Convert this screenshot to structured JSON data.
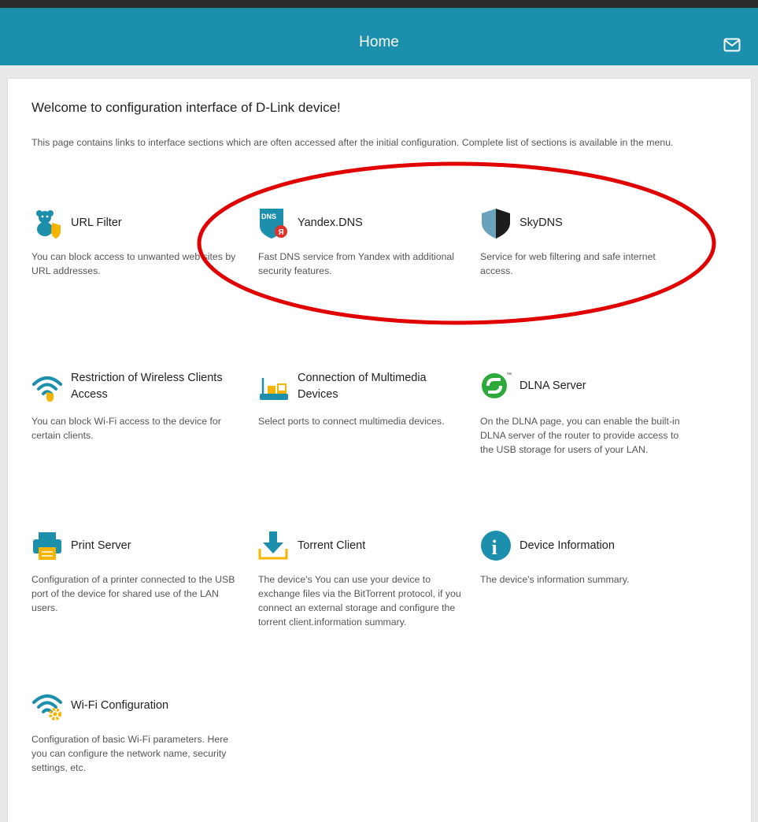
{
  "header": {
    "title": "Home"
  },
  "main": {
    "welcome": "Welcome to configuration interface of D-Link device!",
    "description": "This page contains links to interface sections which are often accessed after the initial configuration. Complete list of sections is available in the menu.",
    "cards": [
      {
        "title": "URL Filter",
        "desc": "You can block access to unwanted web sites by URL addresses."
      },
      {
        "title": "Yandex.DNS",
        "desc": "Fast DNS service from Yandex with additional security features."
      },
      {
        "title": "SkyDNS",
        "desc": "Service for web filtering and safe internet access."
      },
      {
        "title": "Restriction of Wireless Clients Access",
        "desc": "You can block Wi-Fi access to the device for certain clients."
      },
      {
        "title": "Connection of Multimedia Devices",
        "desc": "Select ports to connect multimedia devices."
      },
      {
        "title": "DLNA Server",
        "desc": "On the DLNA page, you can enable the built-in DLNA server of the router to provide access to the USB storage for users of your LAN."
      },
      {
        "title": "Print Server",
        "desc": "Configuration of a printer connected to the USB port of the device for shared use of the LAN users."
      },
      {
        "title": "Torrent Client",
        "desc": "The device's You can use your device to exchange files via the BitTorrent protocol, if you connect an external storage and configure the torrent client.information summary."
      },
      {
        "title": "Device Information",
        "desc": "The device's information summary."
      },
      {
        "title": "Wi-Fi Configuration",
        "desc": "Configuration of basic Wi-Fi parameters. Here you can configure the network name, security settings, etc."
      }
    ],
    "icon_labels": {
      "dns_badge": "DNS",
      "yandex_letter": "Я",
      "info_letter": "i",
      "dlna_mark": "™"
    }
  },
  "colors": {
    "header": "#1b8fab",
    "accent": "#1b8fab",
    "shield_yellow": "#f5b400",
    "annotation": "#e00000"
  }
}
